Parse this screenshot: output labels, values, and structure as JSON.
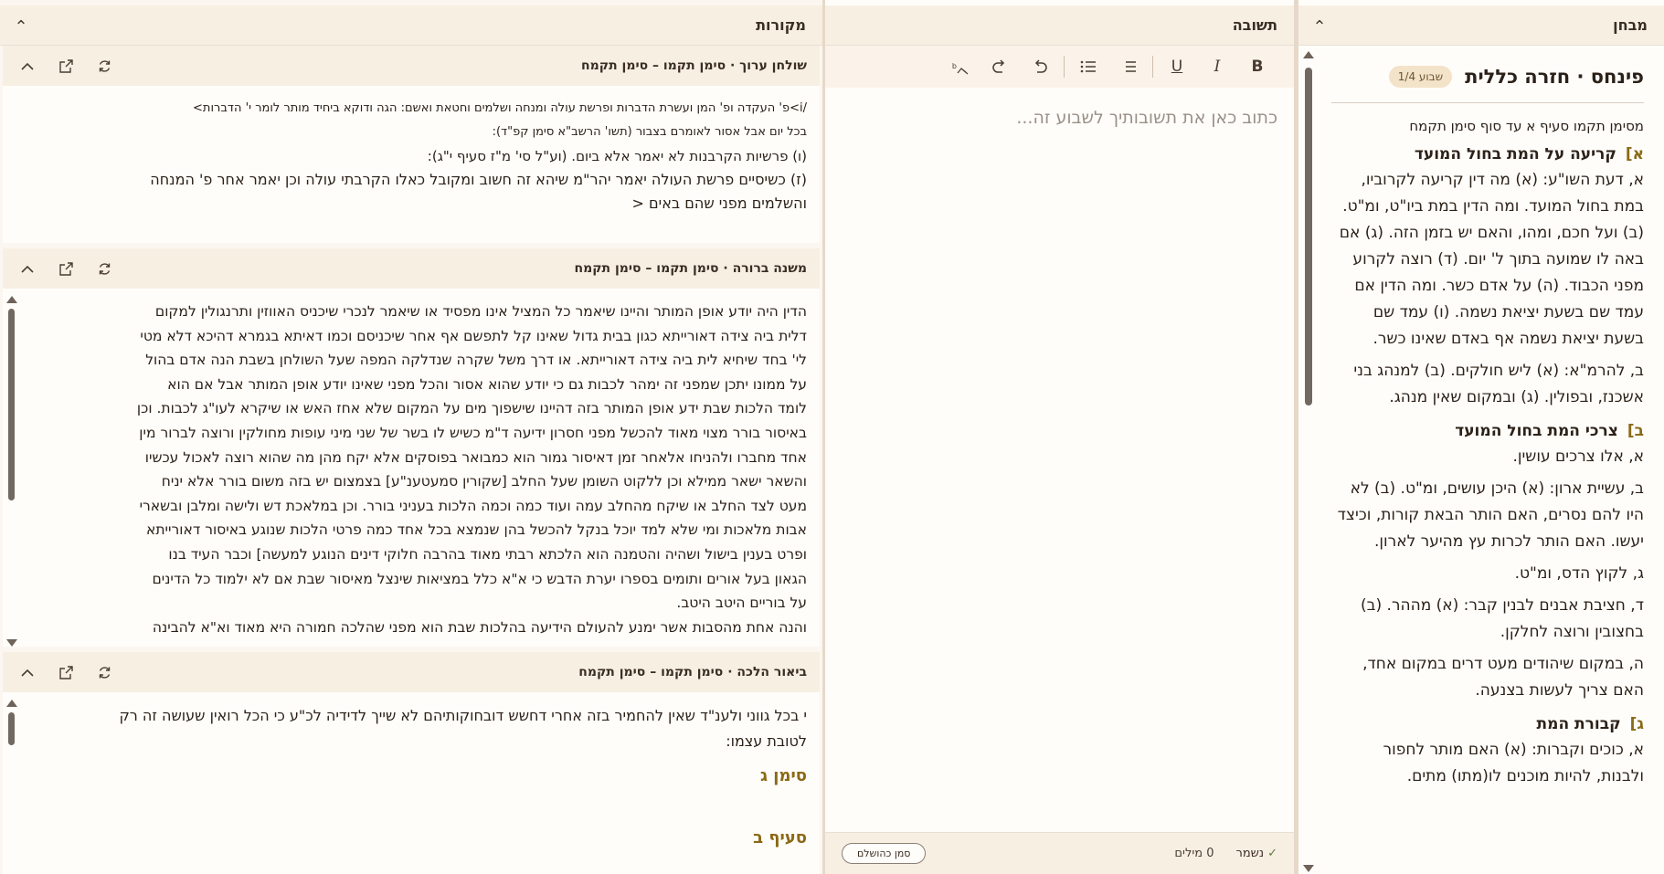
{
  "sources": {
    "title": "מקורות",
    "cards": [
      {
        "title": "שולחן ערוך · סימן תקמו – סימן תקמח",
        "lines": [
          {
            "text": "/i>פ' העקדה ופ' המן ועשרת הדברות ופרשת עולה ומנחה ושלמים וחטאת ואשם: הגה ודוקא ביחיד מותר לומר י' הדברות>",
            "size": "small-mix"
          },
          {
            "text": "בכל יום אבל אסור לאומרם בצבור (תשו' הרשב\"א סימן קפ\"ד):",
            "size": "small"
          },
          {
            "text": "(ו) פרשיות הקרבנות לא יאמר אלא ביום.  (וע\"ל סי' מ\"ז סעיף י\"ג):",
            "size": "normal"
          },
          {
            "text": "(ז) כשיסיים פרשת העולה יאמר יהר\"מ שיהא זה חשוב ומקובל כאלו הקרבתי עולה וכן יאמר אחר פ' המנחה",
            "size": "normal"
          },
          {
            "text": "והשלמים מפני שהם באים <",
            "size": "normal"
          }
        ]
      },
      {
        "title": "משנה ברורה · סימן תקמו – סימן תקמח",
        "lines": [
          "הדין היה יודע אופן המותר והיינו שיאמר כל המציל אינו מפסיד או שיאמר לנכרי שיכניס האווזין ותרנגולין למקום",
          "דלית ביה צידה דאורייתא כגון בבית גדול שאינו קל לתפשם אף אחר שיכניסם וכמו דאיתא בגמרא דהיכא דלא מטי",
          "לי' בחד שיחיא לית ביה צידה דאורייתא. או דרך משל שקרה שנדלקה המפה שעל השולחן בשבת הנה אדם בהול",
          "על ממונו יתכן שמפני זה ימהר לכבות גם כי יודע שהוא אסור והכל מפני שאינו יודע אופן המותר אבל אם הוא",
          "לומד הלכות שבת ידע אופן המותר בזה דהיינו שישפוך מים על המקום שלא אחז האש או שיקרא לעו\"ג לכבות. וכן",
          "באיסור בורר מצוי מאוד להכשל מפני חסרון ידיעה ד\"מ כשיש לו בשר של שני מיני עופות מחולקין ורוצה לברור מין",
          "אחד מחברו ולהניחו אלאחר זמן דאיסור גמור הוא כמבואר בפוסקים אלא יקח מהן מה שהוא רוצה לאכול עכשיו",
          "והשאר ישאר ממילא וכן ללקוט השומן שעל החלב [שקורין סמעטענ\"ע] בצמצום יש בזה משום בורר אלא יניח",
          "מעט לצד החלב או שיקח מהחלב עמה ועוד כמה וכמה הלכות בעניני בורר. וכן במלאכת דש ולישה ומלבן ובשארי",
          "אבות מלאכות ומי שלא למד יוכל בנקל להכשל בהן שנמצא בכל אחד כמה פרטי הלכות שנוגע באיסור דאורייתא",
          "ופרט בענין בישול ושהיה והטמנה הוא הלכתא רבתי מאוד בהרבה חלוקי דינים הנוגע למעשה] וכבר העיד בנו",
          "הגאון בעל אורים ותומים בספרו יערת הדבש כי א\"א כלל במציאות שינצל מאיסור שבת אם לא ילמוד כל הדינים",
          "על בוריים היטב היטב.",
          "והנה אחת מהסבות אשר ימנע להעולם הידיעה בהלכות שבת הוא מפני שהלכה חמורה היא מאוד וא\"א להבינה"
        ]
      },
      {
        "title": "ביאור הלכה · סימן תקמו – סימן תקמח",
        "lines": [
          "י בכל גווני ולענ\"ד שאין להחמיר בזה אחרי דחשש דובחוקותיהם לא שייך לדידיה לכ\"ע כי הכל רואין שעושה זה רק",
          "לטובת עצמו:"
        ],
        "headings": [
          "סימן ג",
          "סעיף ב"
        ]
      }
    ]
  },
  "answer": {
    "title": "תשובה",
    "placeholder": "כתוב כאן את תשובותיך לשבוע זה...",
    "toolbar": {
      "bold": "B",
      "italic": "I",
      "underline": "U"
    },
    "saved_label": "נשמר",
    "word_count": "0 מילים",
    "complete_button": "סמן כהושלם"
  },
  "exam": {
    "title": "מבחן",
    "parsha_title": "פינחס · חזרה כללית",
    "week_badge": "שבוע 1/4",
    "range": "מסימן תקמו סעיף א עד סוף סימן תקמח",
    "sections": [
      {
        "letter": "א]",
        "title": "קריעה על המת בחול המועד",
        "questions": [
          "א, דעת השו\"ע: (א) מה דין קריעה לקרוביו, במת בחול המועד. ומה הדין במת ביו\"ט, ומ\"ט. (ב) ועל חכם, ומהו, והאם יש בזמן הזה. (ג) אם באה לו שמועה בתוך ל' יום. (ד) רוצה לקרוע מפני הכבוד. (ה) על אדם כשר. ומה הדין אם עמד שם בשעת יציאת נשמה. (ו) עמד שם בשעת יציאת נשמה אף באדם שאינו כשר.",
          "ב, להרמ\"א: (א) ליש חולקים. (ב) למנהג בני אשכנז, ובפולין. (ג) ובמקום שאין מנהג."
        ]
      },
      {
        "letter": "ב]",
        "title": "צרכי המת בחול המועד",
        "questions": [
          "א, אלו צרכים עושין.",
          "ב, עשיית ארון: (א) היכן עושים, ומ\"ט. (ב) לא היו להם נסרים, האם הותר הבאת קורות, וכיצד יעשו. האם הותר לכרות עץ מהיער לארון.",
          "ג, לקוץ הדס, ומ\"ט.",
          "ד, חציבת אבנים לבנין קבר: (א) מההר. (ב) בחצובין ורוצה לחלקן.",
          "ה, במקום שיהודים מעט דרים במקום אחד, האם צריך לעשות בצנעה."
        ]
      },
      {
        "letter": "ג]",
        "title": "קבורת המת",
        "questions": [
          "א, כוכים וקברות: (א) האם מותר לחפור ולבנות, להיות מוכנים לו(מתו) מתים."
        ]
      }
    ]
  }
}
